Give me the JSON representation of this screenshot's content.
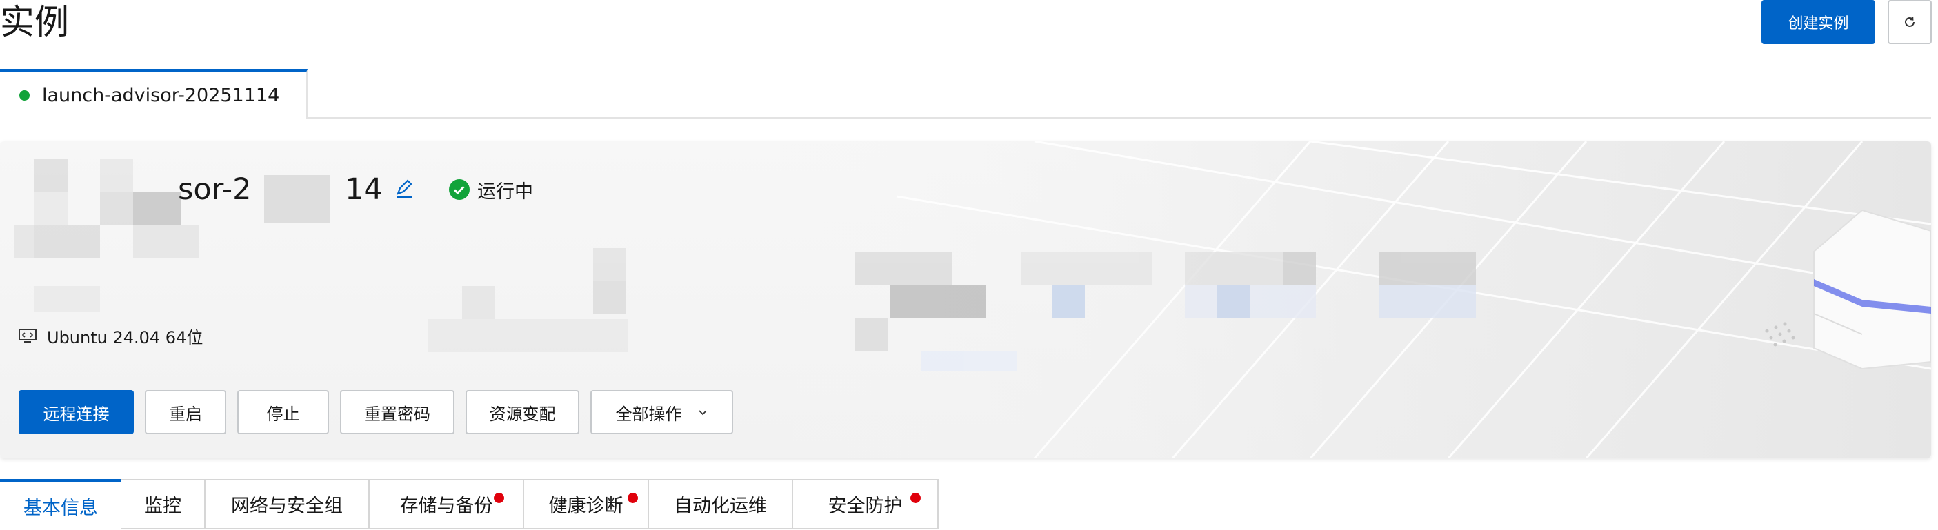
{
  "page": {
    "title": "实例",
    "create_button": "创建实例",
    "refresh_icon": "refresh-icon"
  },
  "instance_tab": {
    "label": "launch-advisor-20251114",
    "status_color": "#12a33a"
  },
  "card": {
    "name_visible": "sor-2",
    "name_tail": "14",
    "status": "运行中",
    "status_color": "#12a33a",
    "os": "Ubuntu 24.04 64位",
    "actions": {
      "remote": "远程连接",
      "restart": "重启",
      "stop": "停止",
      "reset_password": "重置密码",
      "resize": "资源变配",
      "all": "全部操作"
    }
  },
  "detail_tabs": [
    {
      "label": "基本信息",
      "active": true,
      "dot": false
    },
    {
      "label": "监控",
      "active": false,
      "dot": false
    },
    {
      "label": "网络与安全组",
      "active": false,
      "dot": false
    },
    {
      "label": "存储与备份",
      "active": false,
      "dot": true
    },
    {
      "label": "健康诊断",
      "active": false,
      "dot": true
    },
    {
      "label": "自动化运维",
      "active": false,
      "dot": false
    },
    {
      "label": "安全防护",
      "active": false,
      "dot": true
    }
  ],
  "colors": {
    "primary": "#0064c8",
    "alert_dot": "#e0000b"
  }
}
